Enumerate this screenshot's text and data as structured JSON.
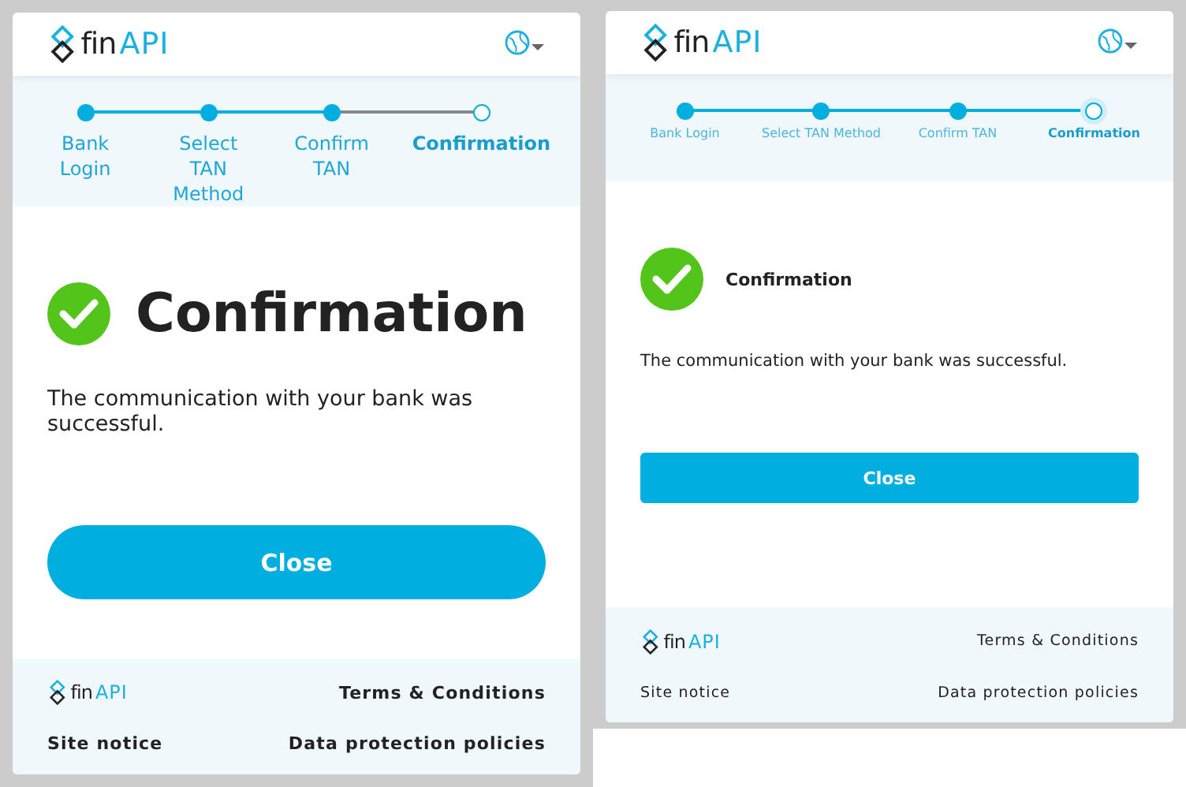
{
  "panels": [
    {
      "kind": "large",
      "logo": {
        "prefix": "fin",
        "brand": "API"
      },
      "steps": [
        {
          "label": "Bank Login",
          "done": true,
          "selected": false
        },
        {
          "label": "Select TAN Method",
          "done": true,
          "selected": false
        },
        {
          "label": "Confirm TAN",
          "done": true,
          "selected": false
        },
        {
          "label": "Confirmation",
          "done": false,
          "selected": true
        }
      ],
      "title": "Confirmation",
      "message": "The communication with your bank was successful.",
      "button": "Close",
      "footer": {
        "logo": {
          "prefix": "fin",
          "brand": "API"
        },
        "links": [
          "Terms & Conditions",
          "Site notice",
          "Data protection policies"
        ]
      }
    },
    {
      "kind": "compact",
      "logo": {
        "prefix": "fin",
        "brand": "API"
      },
      "steps": [
        {
          "label": "Bank Login",
          "done": true,
          "selected": false
        },
        {
          "label": "Select TAN Method",
          "done": true,
          "selected": false
        },
        {
          "label": "Confirm TAN",
          "done": true,
          "selected": false
        },
        {
          "label": "Confirmation",
          "done": false,
          "selected": true
        }
      ],
      "title": "Confirmation",
      "message": "The communication with your bank was successful.",
      "button": "Close",
      "footer": {
        "logo": {
          "prefix": "fin",
          "brand": "API"
        },
        "links": [
          "Terms & Conditions",
          "Site notice",
          "Data protection policies"
        ]
      }
    }
  ]
}
